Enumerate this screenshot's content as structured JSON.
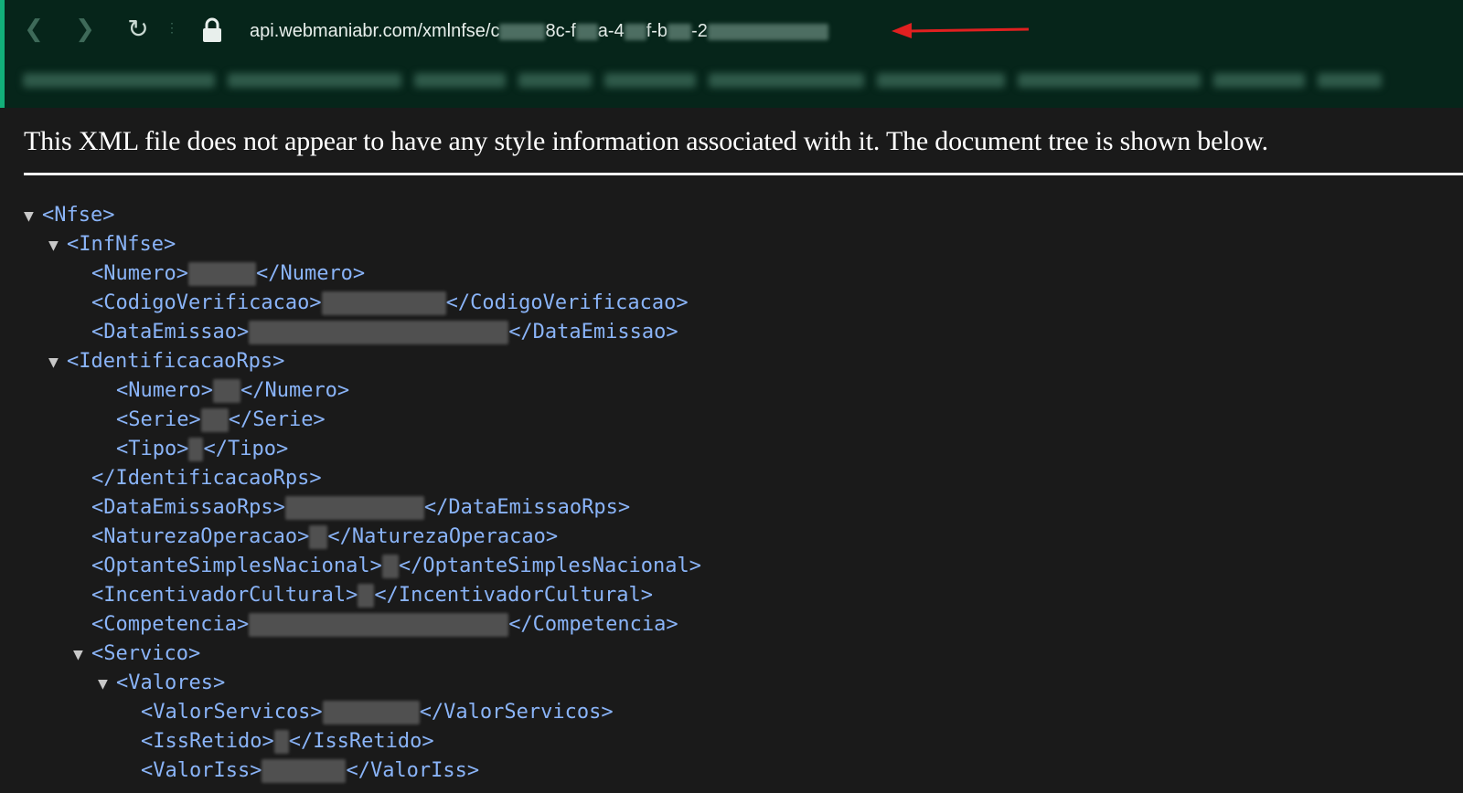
{
  "browser": {
    "url_segments": [
      "api.webmaniabr.com/xmlnfse/c",
      "8c-f",
      "a-4",
      "f-b",
      "-2"
    ],
    "accent_color": "#12b07a",
    "arrow_color": "#e02020"
  },
  "viewer": {
    "notice": "This XML file does not appear to have any style information associated with it. The document tree is shown below."
  },
  "xml_tree": [
    {
      "indent": 0,
      "toggle": "▼",
      "open": "<Nfse>",
      "close": "",
      "blur_w": 0
    },
    {
      "indent": 1,
      "toggle": "▼",
      "open": "<InfNfse>",
      "close": "",
      "blur_w": 0
    },
    {
      "indent": 2,
      "toggle": "",
      "open": "<Numero>",
      "close": "</Numero>",
      "blur_w": 74
    },
    {
      "indent": 2,
      "toggle": "",
      "open": "<CodigoVerificacao>",
      "close": "</CodigoVerificacao>",
      "blur_w": 136
    },
    {
      "indent": 2,
      "toggle": "",
      "open": "<DataEmissao>",
      "close": "</DataEmissao>",
      "blur_w": 284
    },
    {
      "indent": 1,
      "toggle": "▼",
      "open": "<IdentificacaoRps>",
      "close": "",
      "blur_w": 0
    },
    {
      "indent": 3,
      "toggle": "",
      "open": "<Numero>",
      "close": "</Numero>",
      "blur_w": 30
    },
    {
      "indent": 3,
      "toggle": "",
      "open": "<Serie>",
      "close": "</Serie>",
      "blur_w": 30
    },
    {
      "indent": 3,
      "toggle": "",
      "open": "<Tipo>",
      "close": "</Tipo>",
      "blur_w": 16
    },
    {
      "indent": 2,
      "toggle": "",
      "open": "</IdentificacaoRps>",
      "close": "",
      "blur_w": 0
    },
    {
      "indent": 2,
      "toggle": "",
      "open": "<DataEmissaoRps>",
      "close": "</DataEmissaoRps>",
      "blur_w": 152
    },
    {
      "indent": 2,
      "toggle": "",
      "open": "<NaturezaOperacao>",
      "close": "</NaturezaOperacao>",
      "blur_w": 20
    },
    {
      "indent": 2,
      "toggle": "",
      "open": "<OptanteSimplesNacional>",
      "close": "</OptanteSimplesNacional>",
      "blur_w": 18
    },
    {
      "indent": 2,
      "toggle": "",
      "open": "<IncentivadorCultural>",
      "close": "</IncentivadorCultural>",
      "blur_w": 18
    },
    {
      "indent": 2,
      "toggle": "",
      "open": "<Competencia>",
      "close": "</Competencia>",
      "blur_w": 284
    },
    {
      "indent": 1,
      "toggle": "▼",
      "open": "<Servico>",
      "close": "",
      "blur_w": 0,
      "extra_indent": 1
    },
    {
      "indent": 2,
      "toggle": "▼",
      "open": "<Valores>",
      "close": "",
      "blur_w": 0,
      "extra_indent": 1
    },
    {
      "indent": 4,
      "toggle": "",
      "open": "<ValorServicos>",
      "close": "</ValorServicos>",
      "blur_w": 106
    },
    {
      "indent": 4,
      "toggle": "",
      "open": "<IssRetido>",
      "close": "</IssRetido>",
      "blur_w": 16
    },
    {
      "indent": 4,
      "toggle": "",
      "open": "<ValorIss>",
      "close": "</ValorIss>",
      "blur_w": 92
    }
  ]
}
